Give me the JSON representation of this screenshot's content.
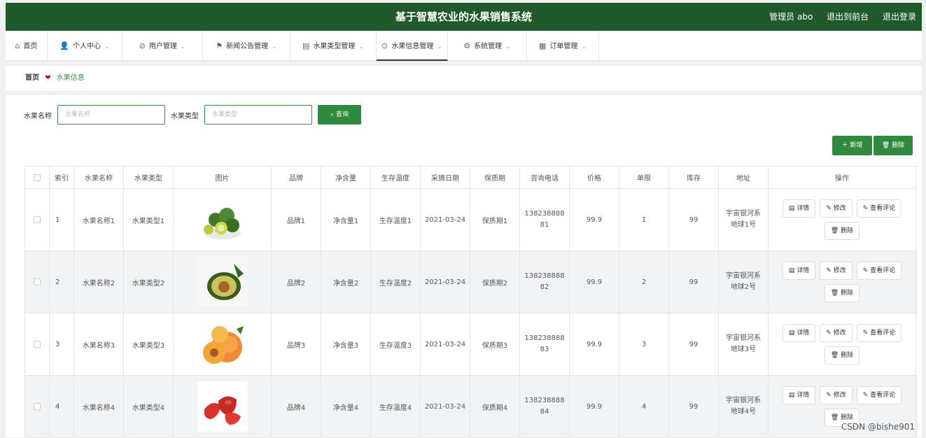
{
  "header": {
    "title": "基于智慧农业的水果销售系统",
    "admin": "管理员 abo",
    "front": "退出到前台",
    "logout": "退出登录"
  },
  "nav": [
    {
      "icon": "home-icon",
      "glyph": "⌂",
      "label": "首页",
      "chev": false
    },
    {
      "icon": "user-icon",
      "glyph": "👤",
      "label": "个人中心",
      "chev": true
    },
    {
      "icon": "user-manage-icon",
      "glyph": "⊘",
      "label": "用户管理",
      "chev": true
    },
    {
      "icon": "flag-icon",
      "glyph": "⚑",
      "label": "新闻公告管理",
      "chev": true
    },
    {
      "icon": "list-icon",
      "glyph": "▤",
      "label": "水果类型管理",
      "chev": true
    },
    {
      "icon": "info-icon",
      "glyph": "⊙",
      "label": "水果信息管理",
      "chev": true
    },
    {
      "icon": "settings-icon",
      "glyph": "⚙",
      "label": "系统管理",
      "chev": true
    },
    {
      "icon": "order-icon",
      "glyph": "▦",
      "label": "订单管理",
      "chev": true
    }
  ],
  "breadcrumb": {
    "home": "首页",
    "current": "水果信息"
  },
  "search": {
    "name_label": "水果名称",
    "name_placeholder": "水果名称",
    "type_label": "水果类型",
    "type_placeholder": "水果类型",
    "query": "查询"
  },
  "actions": {
    "add": "新增",
    "delete": "删除"
  },
  "columns": [
    "索引",
    "水果名称",
    "水果类型",
    "图片",
    "品牌",
    "净含量",
    "生存温度",
    "采摘日期",
    "保质期",
    "咨询电话",
    "价格",
    "单限",
    "库存",
    "地址",
    "操作"
  ],
  "rows": [
    {
      "idx": "1",
      "name": "水果名称1",
      "type": "水果类型1",
      "img": "lime",
      "brand": "品牌1",
      "net": "净含量1",
      "temp": "生存温度1",
      "date": "2021-03-24",
      "shelf": "保质期1",
      "phone": "138238888 81",
      "price": "99.9",
      "limit": "1",
      "stock": "99",
      "addr": "宇宙银河系 地球1号"
    },
    {
      "idx": "2",
      "name": "水果名称2",
      "type": "水果类型2",
      "img": "avocado",
      "brand": "品牌2",
      "net": "净含量2",
      "temp": "生存温度2",
      "date": "2021-03-24",
      "shelf": "保质期2",
      "phone": "138238888 82",
      "price": "99.9",
      "limit": "2",
      "stock": "99",
      "addr": "宇宙银河系 地球2号"
    },
    {
      "idx": "3",
      "name": "水果名称3",
      "type": "水果类型3",
      "img": "apricot",
      "brand": "品牌3",
      "net": "净含量3",
      "temp": "生存温度3",
      "date": "2021-03-24",
      "shelf": "保质期3",
      "phone": "138238888 83",
      "price": "99.9",
      "limit": "3",
      "stock": "99",
      "addr": "宇宙银河系 地球3号"
    },
    {
      "idx": "4",
      "name": "水果名称4",
      "type": "水果类型4",
      "img": "waxapple",
      "brand": "品牌4",
      "net": "净含量4",
      "temp": "生存温度4",
      "date": "2021-03-24",
      "shelf": "保质期4",
      "phone": "138238888 84",
      "price": "99.9",
      "limit": "4",
      "stock": "99",
      "addr": "宇宙银河系 地球4号"
    }
  ],
  "row_ops": {
    "detail": "详情",
    "edit": "修改",
    "comments": "查看评论",
    "delete": "删除"
  },
  "watermark": "CSDN @bishe901"
}
